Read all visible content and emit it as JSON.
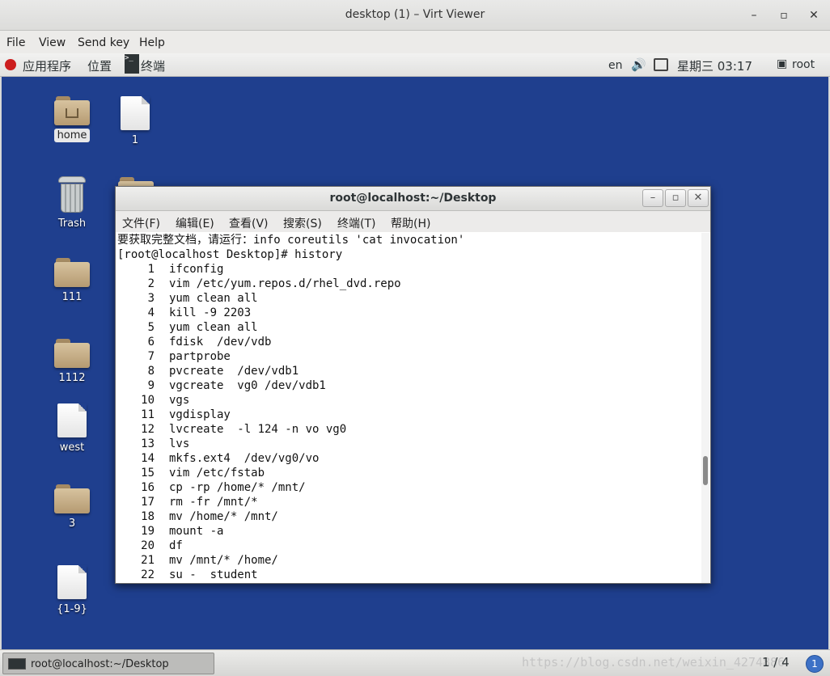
{
  "window": {
    "title": "desktop (1) – Virt Viewer",
    "min": "–",
    "max": "▫",
    "close": "✕"
  },
  "menubar": [
    "File",
    "View",
    "Send key",
    "Help"
  ],
  "top_panel": {
    "apps": "应用程序",
    "places": "位置",
    "terminal": "终端",
    "lang": "en",
    "datetime": "星期三 03:17",
    "user": "root"
  },
  "desktop_icons": [
    {
      "label": "home",
      "type": "home-folder",
      "selected": true
    },
    {
      "label": "1",
      "type": "file"
    },
    {
      "label": "Trash",
      "type": "trash"
    },
    {
      "label": "111",
      "type": "folder"
    },
    {
      "label": "1112",
      "type": "folder"
    },
    {
      "label": "west",
      "type": "file"
    },
    {
      "label": "3",
      "type": "folder"
    },
    {
      "label": "{1-9}",
      "type": "file"
    }
  ],
  "terminal": {
    "title": "root@localhost:~/Desktop",
    "menu": [
      "文件(F)",
      "编辑(E)",
      "查看(V)",
      "搜索(S)",
      "终端(T)",
      "帮助(H)"
    ],
    "pre_lines": [
      "要获取完整文档，请运行：info coreutils 'cat invocation'",
      "[root@localhost Desktop]# history"
    ],
    "history": [
      {
        "n": "1",
        "cmd": "ifconfig"
      },
      {
        "n": "2",
        "cmd": "vim /etc/yum.repos.d/rhel_dvd.repo"
      },
      {
        "n": "3",
        "cmd": "yum clean all"
      },
      {
        "n": "4",
        "cmd": "kill -9 2203"
      },
      {
        "n": "5",
        "cmd": "yum clean all"
      },
      {
        "n": "6",
        "cmd": "fdisk  /dev/vdb"
      },
      {
        "n": "7",
        "cmd": "partprobe"
      },
      {
        "n": "8",
        "cmd": "pvcreate  /dev/vdb1"
      },
      {
        "n": "9",
        "cmd": "vgcreate  vg0 /dev/vdb1"
      },
      {
        "n": "10",
        "cmd": "vgs"
      },
      {
        "n": "11",
        "cmd": "vgdisplay"
      },
      {
        "n": "12",
        "cmd": "lvcreate  -l 124 -n vo vg0"
      },
      {
        "n": "13",
        "cmd": "lvs"
      },
      {
        "n": "14",
        "cmd": "mkfs.ext4  /dev/vg0/vo"
      },
      {
        "n": "15",
        "cmd": "vim /etc/fstab"
      },
      {
        "n": "16",
        "cmd": "cp -rp /home/* /mnt/"
      },
      {
        "n": "17",
        "cmd": "rm -fr /mnt/*"
      },
      {
        "n": "18",
        "cmd": "mv /home/* /mnt/"
      },
      {
        "n": "19",
        "cmd": "mount -a"
      },
      {
        "n": "20",
        "cmd": "df"
      },
      {
        "n": "21",
        "cmd": "mv /mnt/* /home/"
      },
      {
        "n": "22",
        "cmd": "su -  student"
      }
    ]
  },
  "bottom_panel": {
    "task": "root@localhost:~/Desktop",
    "watermark": "https://blog.csdn.net/weixin_4274886",
    "pager": "1 / 4",
    "pager_badge": "1"
  }
}
